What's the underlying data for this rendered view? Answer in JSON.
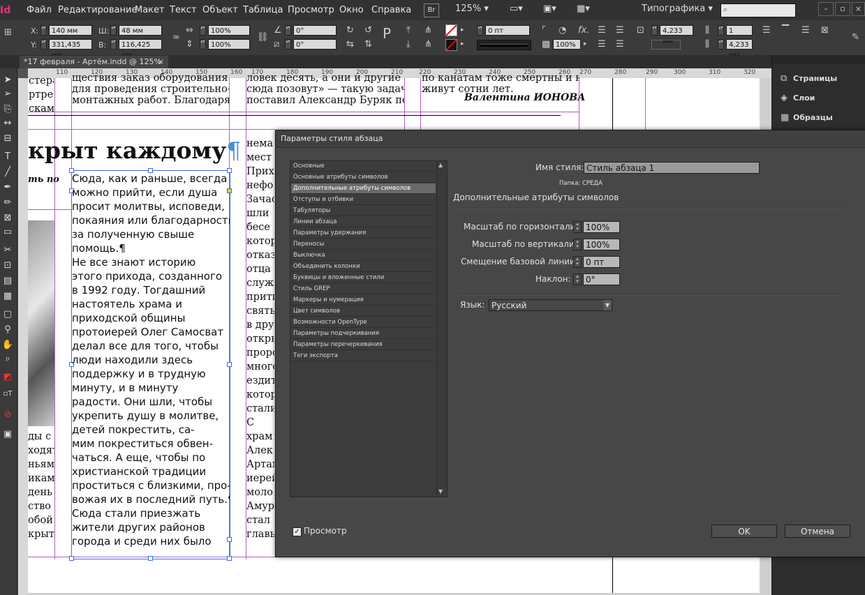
{
  "app": {
    "logo": "Id"
  },
  "menu": [
    "Файл",
    "Редактирование",
    "Макет",
    "Текст",
    "Объект",
    "Таблица",
    "Просмотр",
    "Окно",
    "Справка"
  ],
  "menubar": {
    "bridge": "Br",
    "zoom": "125%",
    "workspace": "Типографика"
  },
  "control": {
    "x_label": "X:",
    "x_value": "140 мм",
    "y_label": "Y:",
    "y_value": "331,435 мм",
    "w_label": "Ш:",
    "w_value": "48 мм",
    "h_label": "В:",
    "h_value": "116,425 мм",
    "scale_x": "100%",
    "scale_y": "100%",
    "rotate": "0°",
    "shear": "0°",
    "stroke_weight": "0 пт",
    "opacity": "100%",
    "gutter": "4,233 мм",
    "columns": "1",
    "inset": "4,233 мм"
  },
  "doc_tab": {
    "title": "*17 февраля - Артём.indd @ 125%",
    "close": "×"
  },
  "ruler_ticks": [
    "110",
    "120",
    "130",
    "140",
    "150",
    "160",
    "170",
    "180",
    "190",
    "200",
    "210",
    "220",
    "230",
    "240",
    "250",
    "260",
    "270",
    "280",
    "290",
    "300",
    "310",
    "320"
  ],
  "document": {
    "headline": "крыт каждому",
    "pilcrow": "¶",
    "subhead": "ть по",
    "top_col1": [
      "стера",
      "ртре-",
      "скам,"
    ],
    "top_col2": [
      "ществия заказ оборудования",
      "для проведения строительно-",
      "монтажных работ. Благодаря"
    ],
    "top_col3": [
      "ловек десять, а они и другие",
      "сюда позовут» — такую задачу",
      "поставил Александр Буряк пе-"
    ],
    "top_col4": [
      "по канатам тоже смертны и не",
      "живут сотни лет."
    ],
    "signature": "Валентина ИОНОВА",
    "main_col": [
      "Сюда, как и раньше, всегда",
      "можно прийти, если душа",
      "просит молитвы, исповеди,",
      "покаяния или благодарности",
      "за полученную свыше",
      "помощь.¶",
      "    Не все знают историю",
      "этого прихода, созданного",
      "в 1992 году. Тогдашний",
      "настоятель храма и",
      "приходской общины",
      "протоиерей Олег Самосват",
      "делал все для того, чтобы",
      "люди находили здесь",
      "поддержку и в трудную",
      "минуту, и в минуту",
      "радости. Они шли, чтобы",
      "укрепить душу в молитве,",
      "детей покрестить, са-",
      "мим покреститься обвен-",
      "чаться. А еще, чтобы по",
      "христианской традиции",
      "проститься с близкими, про-",
      "вожая их в последний путь.¶",
      "    Сюда стали приезжать",
      "жители других районов",
      "города и среди них было"
    ],
    "left_col": [
      "ды с",
      "",
      "ходят",
      "ньям",
      "икам,",
      "день",
      "ство",
      "обой",
      "крыт."
    ],
    "right_col": [
      "нема",
      "мест",
      "Прих",
      "нефо",
      "Зачас",
      "шли",
      "бесе",
      "котор",
      "отказ",
      "",
      "отца",
      "служ",
      "прити",
      "свять",
      "в дру",
      "откры",
      "проро",
      "много",
      "ездит",
      "котор",
      "стали",
      "    С",
      "храм",
      "Алек",
      "Артам",
      "иерей",
      "моло",
      "Амур",
      "стал",
      "главы"
    ]
  },
  "panels": {
    "pages": {
      "label": "Страницы",
      "icon": "pages-icon"
    },
    "layers": {
      "label": "Слои",
      "icon": "layers-icon"
    },
    "swatches": {
      "label": "Образцы",
      "icon": "swatches-icon"
    }
  },
  "dialog": {
    "title": "Параметры стиля абзаца",
    "categories": [
      "Основные",
      "Основные атрибуты символов",
      "Дополнительные атрибуты символов",
      "Отступы и отбивки",
      "Табуляторы",
      "Линии абзаца",
      "Параметры удержания",
      "Переносы",
      "Выключка",
      "Объединить колонки",
      "Буквицы и вложенные стили",
      "Стиль GREP",
      "Маркеры и нумерация",
      "Цвет символов",
      "Возможности OpenType",
      "Параметры подчеркивания",
      "Параметры перечеркивания",
      "Теги экспорта"
    ],
    "selected_index": 2,
    "style_name_label": "Имя стиля:",
    "style_name_value": "Стиль абзаца 1",
    "folder_label": "Папка:",
    "folder_value": "СРЕДА",
    "section_title": "Дополнительные атрибуты символов",
    "h_scale_label": "Масштаб по горизонтали:",
    "h_scale_value": "100%",
    "v_scale_label": "Масштаб по вертикали:",
    "v_scale_value": "100%",
    "baseline_label": "Смещение базовой линии:",
    "baseline_value": "0 пт",
    "skew_label": "Наклон:",
    "skew_value": "0°",
    "language_label": "Язык:",
    "language_value": "Русский",
    "preview_label": "Просмотр",
    "preview_checked": true,
    "ok_label": "OK",
    "cancel_label": "Отмена"
  },
  "colors": {
    "accent_magenta": "#b45cc9",
    "selection": "#4169e1",
    "indesign_pink": "#e0337b"
  }
}
